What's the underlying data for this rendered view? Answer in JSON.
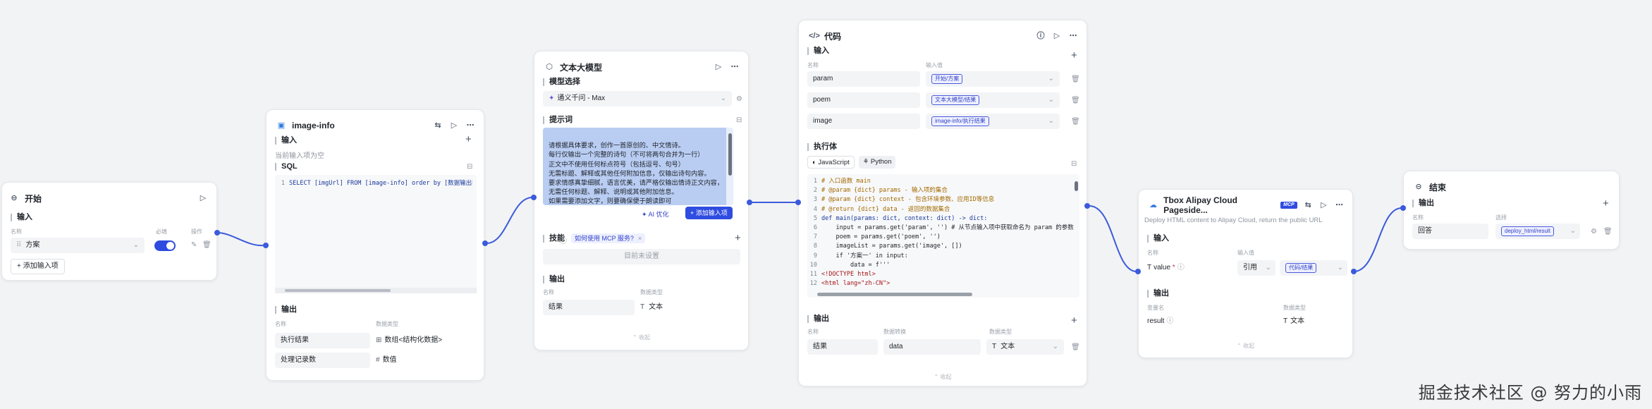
{
  "start": {
    "title": "开始",
    "input_label": "输入",
    "col_name": "名称",
    "col_required": "必填",
    "col_actions": "操作",
    "param": "方案",
    "add_label": "添加输入项"
  },
  "image_info": {
    "title": "image-info",
    "input_label": "输入",
    "input_empty": "当前输入项为空",
    "sql_label": "SQL",
    "sql_code": "SELECT [imgUrl] FROM [image-info] order by [数据输出时",
    "output_label": "输出",
    "col_name": "名称",
    "col_type": "数据类型",
    "rows": [
      {
        "name": "执行结果",
        "type": "数组<结构化数据>"
      },
      {
        "name": "处理记录数",
        "type": "数值"
      }
    ]
  },
  "llm": {
    "title": "文本大模型",
    "model_label": "模型选择",
    "model": "通义千问 - Max",
    "prompt_label": "提示词",
    "prompt_lines": [
      "请根据具体要求，创作一首原创的、中文情诗。",
      "每行仅输出一个完整的诗句（不可将两句合并为一行）",
      "正文中不使用任何标点符号（包括逗号、句号）",
      "无需标题、解释或其他任何附加信息，仅输出诗句内容。",
      "要求情感真挚细腻，语言优美，请严格仅输出情诗正文内容，",
      "无需任何标题、解释、说明或其他附加信息。",
      "如果需要添加文字，则要确保便于朗读即可"
    ],
    "ai_opt": "AI 优化",
    "add_input": "添加输入项",
    "skills_label": "技能",
    "skill_tag": "如何使用 MCP 服务?",
    "skill_empty": "目前未设置",
    "output_label": "输出",
    "col_name": "名称",
    "col_type": "数据类型",
    "out_name": "结果",
    "out_type": "文本",
    "collapse": "收起"
  },
  "code": {
    "title": "代码",
    "input_label": "输入",
    "col_name": "名称",
    "col_value": "输入值",
    "inputs": [
      {
        "name": "param",
        "value": "开始/方案"
      },
      {
        "name": "poem",
        "value": "文本大模型/结果"
      },
      {
        "name": "image",
        "value": "image-info/执行结果"
      }
    ],
    "exec_label": "执行体",
    "lang_js": "JavaScript",
    "lang_py": "Python",
    "code_lines": [
      "# 入口函数 main",
      "# @param {dict} params - 输入项的集合",
      "# @param {dict} context - 包含环境参数、应用ID等信息",
      "# @return {dict} data - 返回的数据集合",
      "def main(params: dict, context: dict) -> dict:",
      "    input = params.get('param', '') # 从节点输入项中获取命名为 param 的参数",
      "    poem = params.get('poem', '')",
      "    imageList = params.get('image', [])",
      "    if '方案一' in input:",
      "        data = f'''",
      "<!DOCTYPE html>",
      "<html lang=\"zh-CN\">"
    ],
    "output_label": "输出",
    "col_var": "数据转换",
    "col_type": "数据类型",
    "out_name": "结果",
    "out_var": "data",
    "out_type": "文本",
    "collapse": "收起"
  },
  "tbox": {
    "title": "Tbox Alipay Cloud Pageside...",
    "badge": "MCP",
    "desc": "Deploy HTML content to Alipay Cloud, return the public URL",
    "input_label": "输入",
    "col_name": "名称",
    "col_input": "输入值",
    "in_name": "value",
    "in_mode": "引用",
    "in_value": "代码/结果",
    "output_label": "输出",
    "col_var": "变量名",
    "col_type": "数据类型",
    "out_name": "result",
    "out_type": "文本",
    "collapse": "收起"
  },
  "end": {
    "title": "结束",
    "output_label": "输出",
    "col_name": "名称",
    "col_value": "选择",
    "out_name": "回答",
    "out_value": "deploy_html/result"
  },
  "watermark": "掘金技术社区 @ 努力的小雨"
}
